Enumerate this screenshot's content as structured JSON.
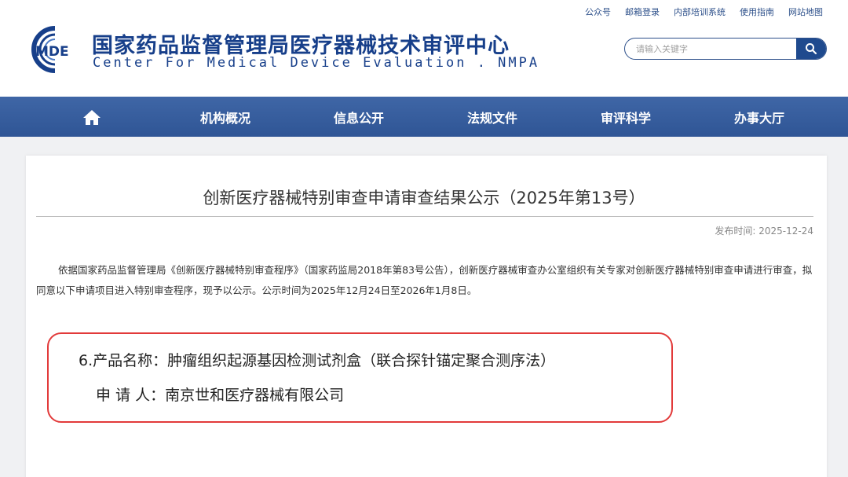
{
  "top_links": [
    "公众号",
    "邮箱登录",
    "内部培训系统",
    "使用指南",
    "网站地图"
  ],
  "logo": {
    "mark_text": "MDE",
    "name_cn": "国家药品监督管理局医疗器械技术审评中心",
    "name_en": "Center For Medical Device Evaluation . NMPA"
  },
  "search": {
    "placeholder": "请输入关键字",
    "icon": "search-icon"
  },
  "nav": {
    "home_icon": "home-icon",
    "items": [
      "机构概况",
      "信息公开",
      "法规文件",
      "审评科学",
      "办事大厅"
    ]
  },
  "article": {
    "title": "创新医疗器械特别审查申请审查结果公示（2025年第13号）",
    "publish_label": "发布时间:",
    "publish_date": "2025-12-24",
    "body": "依据国家药品监督管理局《创新医疗器械特别审查程序》（国家药监局2018年第83号公告），创新医疗器械审查办公室组织有关专家对创新医疗器械特别审查申请进行审查，拟同意以下申请项目进入特别审查程序，现予以公示。公示时间为2025年12月24日至2026年1月8日。",
    "product_line": "6.产品名称：肿瘤组织起源基因检测试剂盒（联合探针锚定聚合测序法）",
    "applicant_line": "申 请 人：南京世和医疗器械有限公司"
  },
  "colors": {
    "brand_blue": "#173f8a",
    "nav_blue": "#2f5595",
    "highlight_red": "#e23a3a"
  }
}
